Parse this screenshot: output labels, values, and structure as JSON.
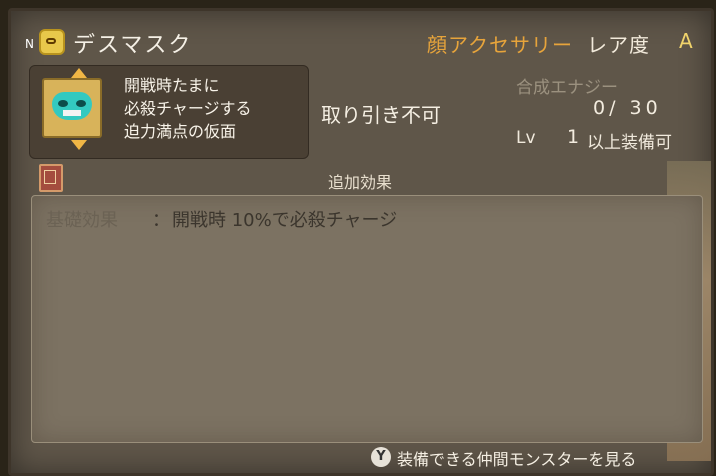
{
  "header": {
    "n_mark": "N",
    "item_name": "デスマスク",
    "category": "顔アクセサリー",
    "rarity_label": "レア度",
    "rarity_value": "A"
  },
  "description": {
    "lines": [
      "開戦時たまに",
      "必殺チャージする",
      "迫力満点の仮面"
    ]
  },
  "trade": "取り引き不可",
  "synth": {
    "label": "合成エナジー",
    "value": "0/ 30"
  },
  "level": {
    "label": "Lv",
    "value": "1",
    "suffix": "以上装備可"
  },
  "effects": {
    "header": "追加効果",
    "name": "基礎効果",
    "separator": "：",
    "text": "開戦時 10%で必殺チャージ"
  },
  "footer": {
    "button": "Y",
    "text": "装備できる仲間モンスターを見る"
  }
}
